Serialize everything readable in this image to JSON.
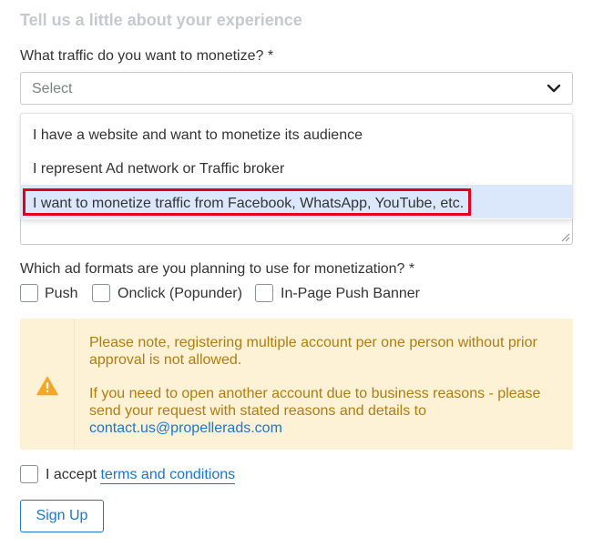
{
  "section_title": "Tell us a little about your experience",
  "traffic_question": {
    "label": "What traffic do you want to monetize? *",
    "placeholder": "Select",
    "options": [
      "I have a website and want to monetize its audience",
      "I represent Ad network or Traffic broker",
      "I want to monetize traffic from Facebook, WhatsApp, YouTube, etc."
    ],
    "highlighted_option": 2
  },
  "ad_formats": {
    "label": "Which ad formats are you planning to use for monetization? *",
    "options": [
      "Push",
      "Onclick (Popunder)",
      "In-Page Push Banner"
    ]
  },
  "notice": {
    "paragraph1": "Please note, registering multiple account per one person without prior approval is not allowed.",
    "paragraph2": "If you need to open another account due to business reasons - please send your request with stated reasons and details to",
    "email": "contact.us@propellerads.com",
    "icon": "warning-icon"
  },
  "accept": {
    "prefix": "I accept",
    "link": "terms and conditions"
  },
  "signup_label": "Sign Up",
  "colors": {
    "accent": "#1a76d2",
    "notice_bg": "#fdf1d6",
    "notice_text": "#b27c12",
    "warning": "#f5a623",
    "highlight_border": "#e2001a",
    "selected_option_bg": "#dbe8fb"
  }
}
